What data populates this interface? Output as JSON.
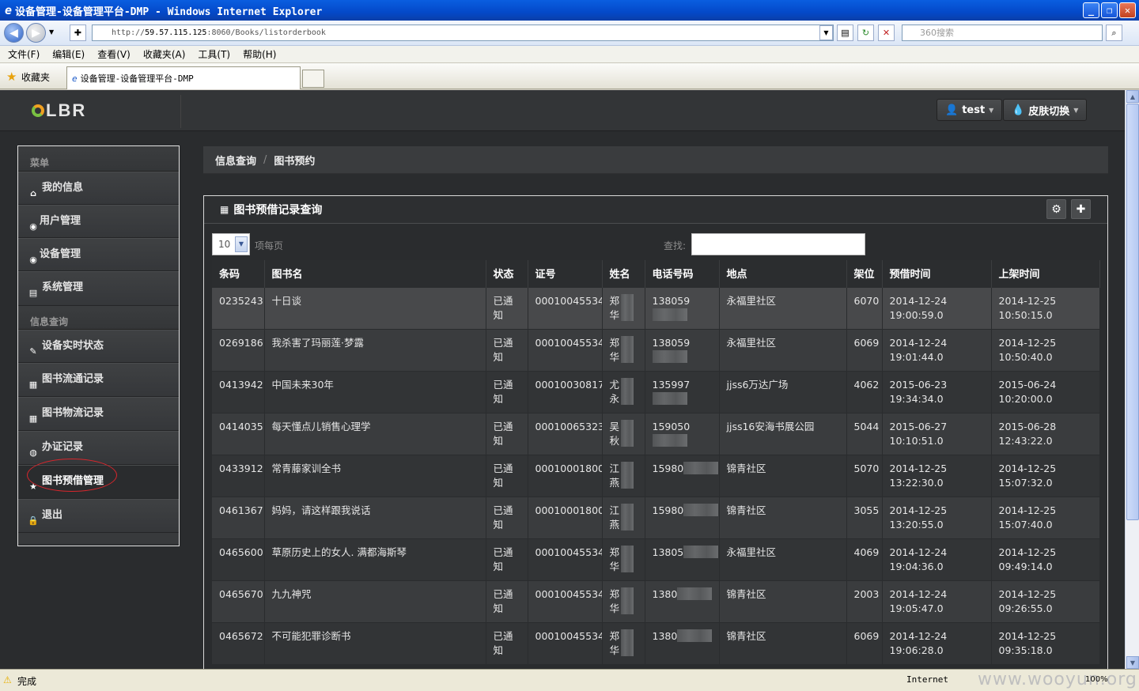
{
  "browser": {
    "window_title": "设备管理-设备管理平台-DMP - Windows Internet Explorer",
    "address_prefix": "http://",
    "address_host": "59.57.115.125",
    "address_path": ":8060/Books/listorderbook",
    "search_placeholder": "360搜索",
    "menu": [
      "文件(F)",
      "编辑(E)",
      "查看(V)",
      "收藏夹(A)",
      "工具(T)",
      "帮助(H)"
    ],
    "favorites_label": "收藏夹",
    "tab_title": "设备管理-设备管理平台-DMP",
    "status_text": "完成",
    "zone_text": "Internet",
    "zoom_text": "100%",
    "watermark": "www.wooyun.org"
  },
  "header": {
    "logo_text": "LBR",
    "user_label": "test",
    "skin_label": "皮肤切换"
  },
  "sidebar": {
    "section_menu": "菜单",
    "section_query": "信息查询",
    "items_menu": [
      {
        "label": "我的信息",
        "icon": "home-icon"
      },
      {
        "label": "用户管理",
        "icon": "eye-icon"
      },
      {
        "label": "设备管理",
        "icon": "eye-icon"
      },
      {
        "label": "系统管理",
        "icon": "list-icon"
      }
    ],
    "items_query": [
      {
        "label": "设备实时状态",
        "icon": "edit-icon"
      },
      {
        "label": "图书流通记录",
        "icon": "calendar-icon"
      },
      {
        "label": "图书物流记录",
        "icon": "grid-icon"
      },
      {
        "label": "办证记录",
        "icon": "globe-icon"
      },
      {
        "label": "图书预借管理",
        "icon": "star-icon"
      },
      {
        "label": "退出",
        "icon": "lock-icon"
      }
    ]
  },
  "breadcrumb": {
    "root": "信息查询",
    "current": "图书预约"
  },
  "panel": {
    "title": "图书预借记录查询",
    "page_size": "10",
    "page_size_label": "项每页",
    "search_label": "查找:"
  },
  "table": {
    "columns": [
      "条码",
      "图书名",
      "状态",
      "证号",
      "姓名",
      "电话号码",
      "地点",
      "架位",
      "预借时间",
      "上架时间"
    ],
    "rows": [
      {
        "barcode": "0235243",
        "title": "十日谈",
        "status": "已通知",
        "card": "00010045534",
        "name": "郑华",
        "phone": "138059",
        "place": "永福里社区",
        "shelf": "6070",
        "reserve_d": "2014-12-24",
        "reserve_t": "19:00:59.0",
        "shelf_d": "2014-12-25",
        "shelf_t": "10:50:15.0"
      },
      {
        "barcode": "0269186",
        "title": "我杀害了玛丽莲·梦露",
        "status": "已通知",
        "card": "00010045534",
        "name": "郑华",
        "phone": "138059",
        "place": "永福里社区",
        "shelf": "6069",
        "reserve_d": "2014-12-24",
        "reserve_t": "19:01:44.0",
        "shelf_d": "2014-12-25",
        "shelf_t": "10:50:40.0"
      },
      {
        "barcode": "0413942",
        "title": "中国未来30年",
        "status": "已通知",
        "card": "00010030817",
        "name": "尤永",
        "phone": "135997",
        "place": "jjss6万达广场",
        "shelf": "4062",
        "reserve_d": "2015-06-23",
        "reserve_t": "19:34:34.0",
        "shelf_d": "2015-06-24",
        "shelf_t": "10:20:00.0"
      },
      {
        "barcode": "0414035",
        "title": "每天懂点儿销售心理学",
        "status": "已通知",
        "card": "00010065323",
        "name": "吴秋",
        "phone": "159050",
        "place": "jjss16安海书展公园",
        "shelf": "5044",
        "reserve_d": "2015-06-27",
        "reserve_t": "10:10:51.0",
        "shelf_d": "2015-06-28",
        "shelf_t": "12:43:22.0"
      },
      {
        "barcode": "0433912",
        "title": "常青藤家训全书",
        "status": "已通知",
        "card": "00010001800",
        "name": "江燕",
        "phone": "15980",
        "place": "锦青社区",
        "shelf": "5070",
        "reserve_d": "2014-12-25",
        "reserve_t": "13:22:30.0",
        "shelf_d": "2014-12-25",
        "shelf_t": "15:07:32.0"
      },
      {
        "barcode": "0461367",
        "title": "妈妈，请这样跟我说话",
        "status": "已通知",
        "card": "00010001800",
        "name": "江燕",
        "phone": "15980",
        "place": "锦青社区",
        "shelf": "3055",
        "reserve_d": "2014-12-25",
        "reserve_t": "13:20:55.0",
        "shelf_d": "2014-12-25",
        "shelf_t": "15:07:40.0"
      },
      {
        "barcode": "0465600",
        "title": "草原历史上的女人. 满都海斯琴",
        "status": "已通知",
        "card": "00010045534",
        "name": "郑华",
        "phone": "13805",
        "place": "永福里社区",
        "shelf": "4069",
        "reserve_d": "2014-12-24",
        "reserve_t": "19:04:36.0",
        "shelf_d": "2014-12-25",
        "shelf_t": "09:49:14.0"
      },
      {
        "barcode": "0465670",
        "title": "九九神咒",
        "status": "已通知",
        "card": "00010045534",
        "name": "郑华",
        "phone": "1380",
        "place": "锦青社区",
        "shelf": "2003",
        "reserve_d": "2014-12-24",
        "reserve_t": "19:05:47.0",
        "shelf_d": "2014-12-25",
        "shelf_t": "09:26:55.0"
      },
      {
        "barcode": "0465672",
        "title": "不可能犯罪诊断书",
        "status": "已通知",
        "card": "00010045534",
        "name": "郑华",
        "phone": "1380",
        "place": "锦青社区",
        "shelf": "6069",
        "reserve_d": "2014-12-24",
        "reserve_t": "19:06:28.0",
        "shelf_d": "2014-12-25",
        "shelf_t": "09:35:18.0"
      }
    ]
  }
}
